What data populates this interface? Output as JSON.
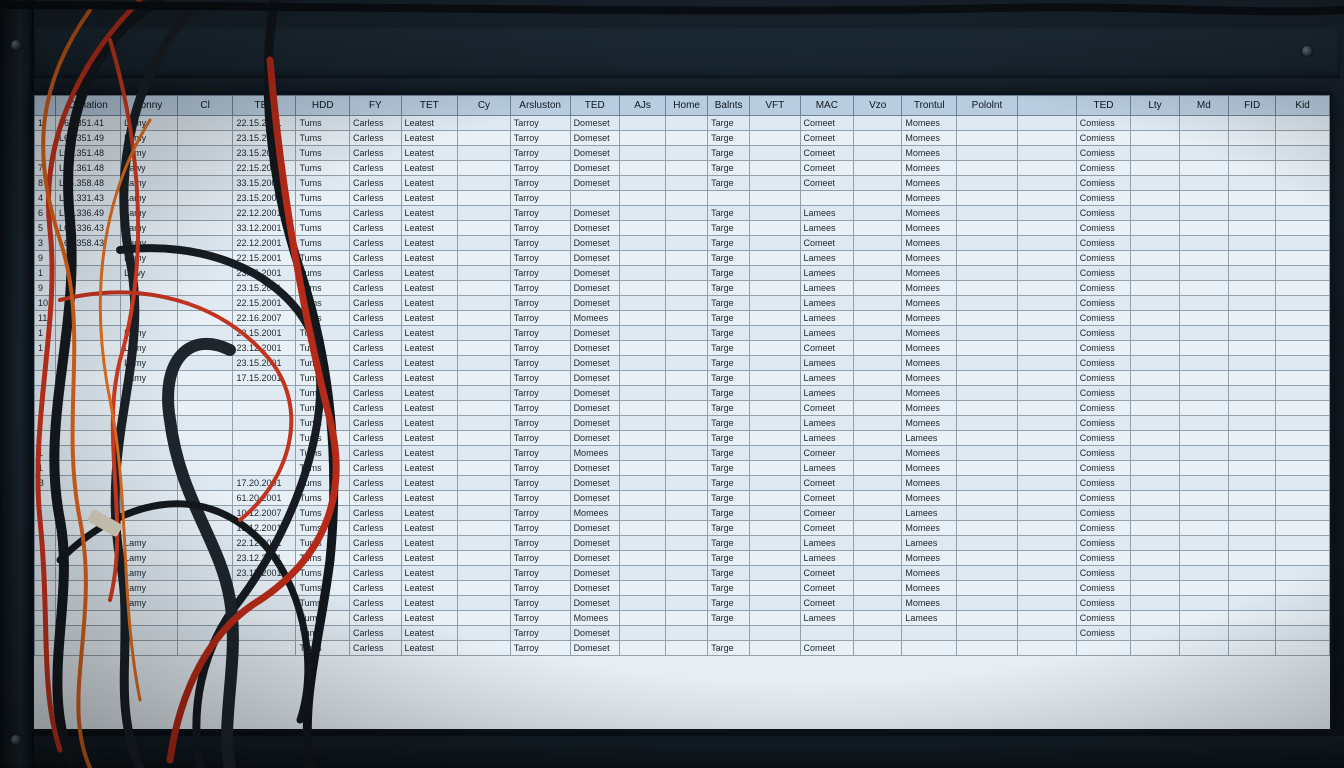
{
  "columns": [
    "",
    "Opliation",
    "Tonny",
    "Cl",
    "TED",
    "HDD",
    "FY",
    "TET",
    "Cy",
    "Arsluston",
    "TED",
    "AJs",
    "Home",
    "Balnts",
    "VFT",
    "MAC",
    "Vzo",
    "Trontul",
    "Pololnt",
    "",
    "TED",
    "Lty",
    "Md",
    "FID",
    "Kid"
  ],
  "rows": [
    {
      "idx": "1",
      "c1": "L65.351.41",
      "c2": "Lamy",
      "c3": "",
      "c4": "22.15.2001",
      "c5": "Tums",
      "c6": "Carless",
      "c7": "Leatest",
      "c9": "Tarroy",
      "c10": "Domeset",
      "c13": "Targe",
      "c15": "Comeet",
      "c17": "Momees",
      "c20": "Comiess"
    },
    {
      "idx": "",
      "c1": "L65.351.49",
      "c2": "Lamy",
      "c4": "23.15.2001",
      "c5": "Tums",
      "c6": "Carless",
      "c7": "Leatest",
      "c9": "Tarroy",
      "c10": "Domeset",
      "c13": "Targe",
      "c15": "Comeet",
      "c17": "Momees",
      "c20": "Comiess"
    },
    {
      "idx": "",
      "c1": "L65.351.48",
      "c2": "Lamy",
      "c4": "23.15.2001",
      "c5": "Tums",
      "c6": "Carless",
      "c7": "Leatest",
      "c9": "Tarroy",
      "c10": "Domeset",
      "c13": "Targe",
      "c15": "Comeet",
      "c17": "Momees",
      "c20": "Comiess"
    },
    {
      "idx": "7",
      "c1": "L65.361.48",
      "c2": "Fawy",
      "c4": "22.15.2001",
      "c5": "Tums",
      "c6": "Carless",
      "c7": "Leatest",
      "c9": "Tarroy",
      "c10": "Domeset",
      "c13": "Targe",
      "c15": "Comeet",
      "c17": "Momees",
      "c20": "Comiess"
    },
    {
      "idx": "8",
      "c1": "L65.358.48",
      "c2": "Lamy",
      "c4": "33.15.2007",
      "c5": "Tums",
      "c6": "Carless",
      "c7": "Leatest",
      "c9": "Tarroy",
      "c10": "Domeset",
      "c13": "Targe",
      "c15": "Comeet",
      "c17": "Momees",
      "c20": "Comiess"
    },
    {
      "idx": "4",
      "c1": "L65.331.43",
      "c2": "Lamy",
      "c4": "23.15.2001",
      "c5": "Tums",
      "c6": "Carless",
      "c7": "Leatest",
      "c9": "Tarroy",
      "c10": "",
      "c13": "",
      "c15": "",
      "c17": "Momees",
      "c20": "Comiess"
    },
    {
      "idx": "6",
      "c1": "L65.336.49",
      "c2": "Lamy",
      "c4": "22.12.2001",
      "c5": "Tums",
      "c6": "Carless",
      "c7": "Leatest",
      "c9": "Tarroy",
      "c10": "Domeset",
      "c13": "Targe",
      "c15": "Lamees",
      "c17": "Momees",
      "c20": "Comiess"
    },
    {
      "idx": "5",
      "c1": "L65.336.43",
      "c2": "Lamy",
      "c4": "33.12.2001",
      "c5": "Tums",
      "c6": "Carless",
      "c7": "Leatest",
      "c9": "Tarroy",
      "c10": "Domeset",
      "c13": "Targe",
      "c15": "Lamees",
      "c17": "Momees",
      "c20": "Comiess"
    },
    {
      "idx": "3",
      "c1": "L65.358.43",
      "c2": "Lamy",
      "c4": "22.12.2001",
      "c5": "Tums",
      "c6": "Carless",
      "c7": "Leatest",
      "c9": "Tarroy",
      "c10": "Domeset",
      "c13": "Targe",
      "c15": "Comeet",
      "c17": "Momees",
      "c20": "Comiess"
    },
    {
      "idx": "9",
      "c1": "",
      "c2": "Lamy",
      "c4": "22.15.2001",
      "c5": "Tums",
      "c6": "Carless",
      "c7": "Leatest",
      "c9": "Tarroy",
      "c10": "Domeset",
      "c13": "Targe",
      "c15": "Lamees",
      "c17": "Momees",
      "c20": "Comiess"
    },
    {
      "idx": "1",
      "c1": "",
      "c2": "Lawy",
      "c4": "23.15.2001",
      "c5": "Tums",
      "c6": "Carless",
      "c7": "Leatest",
      "c9": "Tarroy",
      "c10": "Domeset",
      "c13": "Targe",
      "c15": "Lamees",
      "c17": "Momees",
      "c20": "Comiess"
    },
    {
      "idx": "9",
      "c1": "",
      "c2": "",
      "c4": "23.15.2001",
      "c5": "Tums",
      "c6": "Carless",
      "c7": "Leatest",
      "c9": "Tarroy",
      "c10": "Domeset",
      "c13": "Targe",
      "c15": "Lamees",
      "c17": "Momees",
      "c20": "Comiess"
    },
    {
      "idx": "10",
      "c1": "",
      "c2": "",
      "c4": "22.15.2001",
      "c5": "Tums",
      "c6": "Carless",
      "c7": "Leatest",
      "c9": "Tarroy",
      "c10": "Domeset",
      "c13": "Targe",
      "c15": "Lamees",
      "c17": "Momees",
      "c20": "Comiess"
    },
    {
      "idx": "11",
      "c1": "",
      "c2": "",
      "c4": "22.16.2007",
      "c5": "Tums",
      "c6": "Carless",
      "c7": "Leatest",
      "c9": "Tarroy",
      "c10": "Momees",
      "c13": "Targe",
      "c15": "Lamees",
      "c17": "Momees",
      "c20": "Comiess"
    },
    {
      "idx": "1",
      "c1": "",
      "c2": "Lamy",
      "c4": "23.15.2001",
      "c5": "Tums",
      "c6": "Carless",
      "c7": "Leatest",
      "c9": "Tarroy",
      "c10": "Domeset",
      "c13": "Targe",
      "c15": "Lamees",
      "c17": "Momees",
      "c20": "Comiess"
    },
    {
      "idx": "1",
      "c1": "",
      "c2": "Lamy",
      "c4": "23.12.2001",
      "c5": "Tums",
      "c6": "Carless",
      "c7": "Leatest",
      "c9": "Tarroy",
      "c10": "Domeset",
      "c13": "Targe",
      "c15": "Comeet",
      "c17": "Momees",
      "c20": "Comiess"
    },
    {
      "idx": "",
      "c1": "",
      "c2": "Lamy",
      "c4": "23.15.2001",
      "c5": "Tums",
      "c6": "Carless",
      "c7": "Leatest",
      "c9": "Tarroy",
      "c10": "Domeset",
      "c13": "Targe",
      "c15": "Lamees",
      "c17": "Momees",
      "c20": "Comiess"
    },
    {
      "idx": "",
      "c1": "",
      "c2": "Lamy",
      "c4": "17.15.2001",
      "c5": "Tums",
      "c6": "Carless",
      "c7": "Leatest",
      "c9": "Tarroy",
      "c10": "Domeset",
      "c13": "Targe",
      "c15": "Lamees",
      "c17": "Momees",
      "c20": "Comiess"
    },
    {
      "idx": "",
      "c1": "",
      "c2": "",
      "c4": "",
      "c5": "Tums",
      "c6": "Carless",
      "c7": "Leatest",
      "c9": "Tarroy",
      "c10": "Domeset",
      "c13": "Targe",
      "c15": "Lamees",
      "c17": "Momees",
      "c20": "Comiess"
    },
    {
      "idx": "",
      "c1": "",
      "c2": "",
      "c4": "",
      "c5": "Tums",
      "c6": "Carless",
      "c7": "Leatest",
      "c9": "Tarroy",
      "c10": "Domeset",
      "c13": "Targe",
      "c15": "Comeet",
      "c17": "Momees",
      "c20": "Comiess"
    },
    {
      "idx": "",
      "c1": "",
      "c2": "",
      "c4": "",
      "c5": "Tums",
      "c6": "Carless",
      "c7": "Leatest",
      "c9": "Tarroy",
      "c10": "Domeset",
      "c13": "Targe",
      "c15": "Lamees",
      "c17": "Momees",
      "c20": "Comiess"
    },
    {
      "idx": "",
      "c1": "",
      "c2": "",
      "c4": "",
      "c5": "Tums",
      "c6": "Carless",
      "c7": "Leatest",
      "c9": "Tarroy",
      "c10": "Domeset",
      "c13": "Targe",
      "c15": "Lamees",
      "c17": "Lamees",
      "c20": "Comiess"
    },
    {
      "idx": "1",
      "c1": "",
      "c2": "",
      "c4": "",
      "c5": "Tums",
      "c6": "Carless",
      "c7": "Leatest",
      "c9": "Tarroy",
      "c10": "Momees",
      "c13": "Targe",
      "c15": "Comeer",
      "c17": "Momees",
      "c20": "Comiess"
    },
    {
      "idx": "1",
      "c1": "",
      "c2": "",
      "c4": "",
      "c5": "Tums",
      "c6": "Carless",
      "c7": "Leatest",
      "c9": "Tarroy",
      "c10": "Domeset",
      "c13": "Targe",
      "c15": "Lamees",
      "c17": "Momees",
      "c20": "Comiess"
    },
    {
      "idx": "B",
      "c1": "",
      "c2": "",
      "c4": "17.20.2001",
      "c5": "Tums",
      "c6": "Carless",
      "c7": "Leatest",
      "c9": "Tarroy",
      "c10": "Domeset",
      "c13": "Targe",
      "c15": "Comeet",
      "c17": "Momees",
      "c20": "Comiess"
    },
    {
      "idx": "",
      "c1": "",
      "c2": "",
      "c4": "61.20.2001",
      "c5": "Tums",
      "c6": "Carless",
      "c7": "Leatest",
      "c9": "Tarroy",
      "c10": "Domeset",
      "c13": "Targe",
      "c15": "Comeet",
      "c17": "Momees",
      "c20": "Comiess"
    },
    {
      "idx": "",
      "c1": "",
      "c2": "",
      "c4": "10.12.2007",
      "c5": "Tums",
      "c6": "Carless",
      "c7": "Leatest",
      "c9": "Tarroy",
      "c10": "Momees",
      "c13": "Targe",
      "c15": "Comeer",
      "c17": "Lamees",
      "c20": "Comiess"
    },
    {
      "idx": "",
      "c1": "",
      "c2": "",
      "c4": "13.12.2001",
      "c5": "Tums",
      "c6": "Carless",
      "c7": "Leatest",
      "c9": "Tarroy",
      "c10": "Domeset",
      "c13": "Targe",
      "c15": "Comeet",
      "c17": "Momees",
      "c20": "Comiess"
    },
    {
      "idx": "",
      "c1": "",
      "c2": "Lamy",
      "c4": "22.12.2001",
      "c5": "Tums",
      "c6": "Carless",
      "c7": "Leatest",
      "c9": "Tarroy",
      "c10": "Domeset",
      "c13": "Targe",
      "c15": "Lamees",
      "c17": "Lamees",
      "c20": "Comiess"
    },
    {
      "idx": "",
      "c1": "",
      "c2": "Lamy",
      "c4": "23.12.2001",
      "c5": "Tums",
      "c6": "Carless",
      "c7": "Leatest",
      "c9": "Tarroy",
      "c10": "Domeset",
      "c13": "Targe",
      "c15": "Lamees",
      "c17": "Momees",
      "c20": "Comiess"
    },
    {
      "idx": "",
      "c1": "",
      "c2": "Lamy",
      "c4": "23.15.2001",
      "c5": "Tums",
      "c6": "Carless",
      "c7": "Leatest",
      "c9": "Tarroy",
      "c10": "Domeset",
      "c13": "Targe",
      "c15": "Comeet",
      "c17": "Momees",
      "c20": "Comiess"
    },
    {
      "idx": "",
      "c1": "",
      "c2": "Lamy",
      "c4": "",
      "c5": "Tums",
      "c6": "Carless",
      "c7": "Leatest",
      "c9": "Tarroy",
      "c10": "Domeset",
      "c13": "Targe",
      "c15": "Comeet",
      "c17": "Momees",
      "c20": "Comiess"
    },
    {
      "idx": "",
      "c1": "",
      "c2": "Lamy",
      "c4": "",
      "c5": "Tums",
      "c6": "Carless",
      "c7": "Leatest",
      "c9": "Tarroy",
      "c10": "Domeset",
      "c13": "Targe",
      "c15": "Comeet",
      "c17": "Momees",
      "c20": "Comiess"
    },
    {
      "idx": "",
      "c1": "",
      "c2": "",
      "c4": "",
      "c5": "Tums",
      "c6": "Carless",
      "c7": "Leatest",
      "c9": "Tarroy",
      "c10": "Momees",
      "c13": "Targe",
      "c15": "Lamees",
      "c17": "Lamees",
      "c20": "Comiess"
    },
    {
      "idx": "",
      "c1": "",
      "c2": "",
      "c4": "",
      "c5": "Tums",
      "c6": "Carless",
      "c7": "Leatest",
      "c9": "Tarroy",
      "c10": "Domeset",
      "c13": "",
      "c15": "",
      "c17": "",
      "c20": "Comiess"
    },
    {
      "idx": "",
      "c1": "",
      "c2": "",
      "c4": "",
      "c5": "Tums",
      "c6": "Carless",
      "c7": "Leatest",
      "c9": "Tarroy",
      "c10": "Domeset",
      "c13": "Targe",
      "c15": "Comeet",
      "c17": "",
      "c20": ""
    }
  ],
  "colors": {
    "header_bg": "#b9cde0",
    "cell_bg": "#e6eef4",
    "rack_bg": "#121b24",
    "cable_red": "#c8321e",
    "cable_orange": "#d9621a",
    "cable_black": "#151a1f"
  }
}
